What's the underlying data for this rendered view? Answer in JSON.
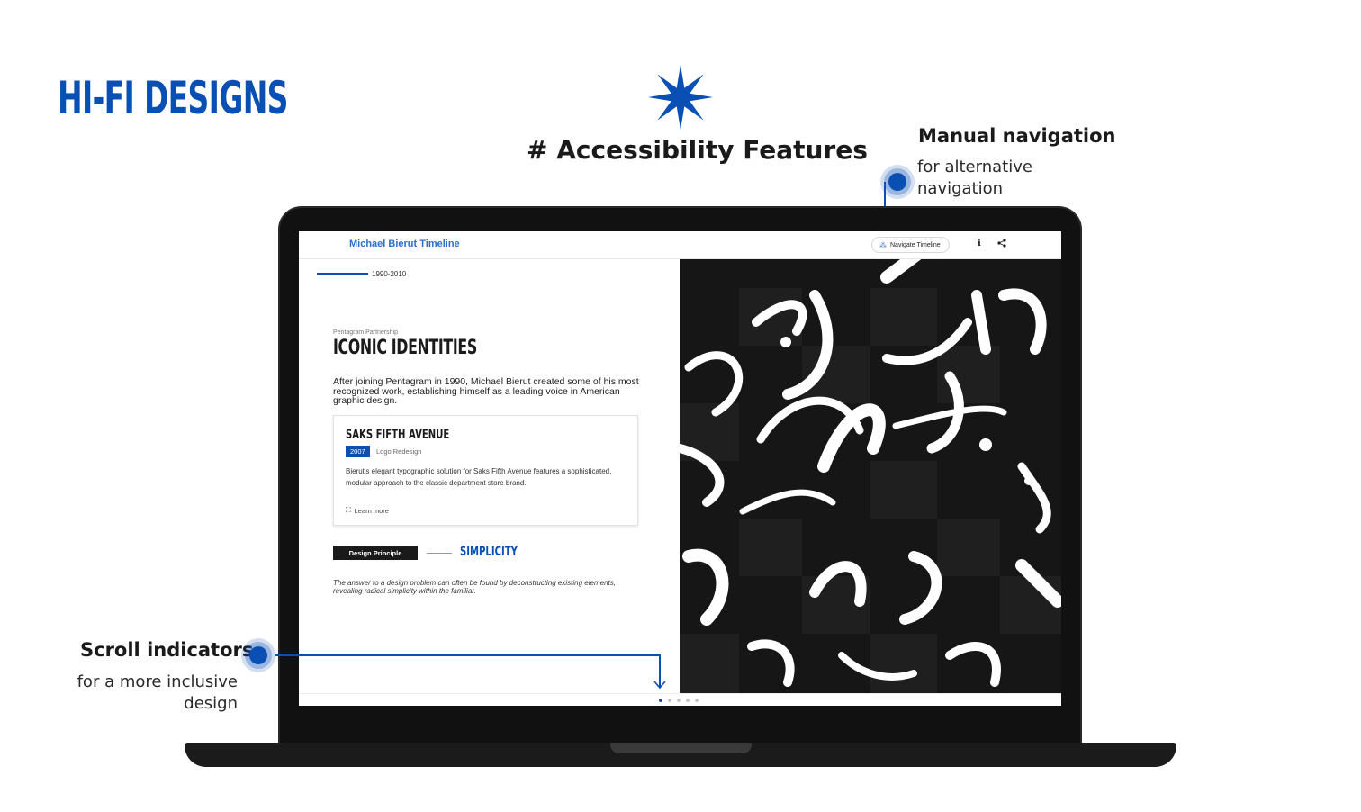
{
  "page": {
    "heading": "HI-FI DESIGNS",
    "section_heading": "# Accessibility Features",
    "accent_color": "#0a4fb4"
  },
  "annotations": {
    "manual_nav": {
      "title": "Manual navigation",
      "subtitle": "for alternative navigation"
    },
    "scroll": {
      "title": "Scroll indicators",
      "subtitle": "for a more inclusive design"
    }
  },
  "app": {
    "brand": "Michael Bierut Timeline",
    "navigate_button": "Navigate Timeline",
    "info_icon": "info-icon",
    "share_icon": "share-icon",
    "era": "1990-2010",
    "kicker": "Pentagram Partnership",
    "section_title": "ICONIC IDENTITIES",
    "intro": "After joining Pentagram in 1990, Michael Bierut created some of his most recognized work, establishing himself as a leading voice in American graphic design.",
    "card": {
      "title": "SAKS FIFTH AVENUE",
      "year": "2007",
      "category": "Logo Redesign",
      "body": "Bierut's elegant typographic solution for Saks Fifth Avenue features a sophisticated, modular approach to the classic department store brand.",
      "learn_more": "Learn more"
    },
    "principle": {
      "badge": "Design Principle",
      "word": "SIMPLICITY",
      "quote": "The answer to a design problem can often be found by deconstructing existing elements, revealing radical simplicity within the familiar."
    },
    "scroll_dots": {
      "count": 5,
      "active_index": 0
    }
  }
}
